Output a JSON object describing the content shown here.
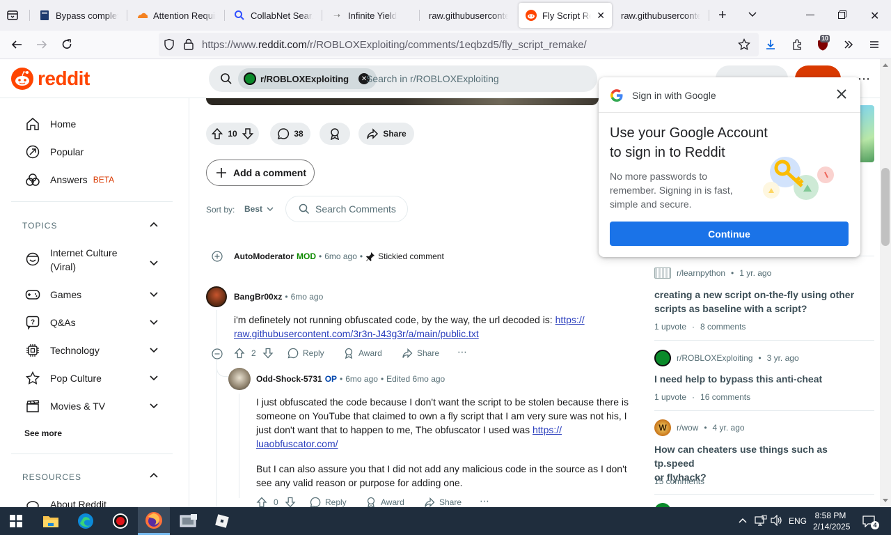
{
  "browser": {
    "tabs": [
      {
        "label": "Bypass complete |",
        "icon": "doc-icon"
      },
      {
        "label": "Attention Require",
        "icon": "cloudflare-icon"
      },
      {
        "label": "CollabNet SearXN",
        "icon": "search-icon"
      },
      {
        "label": "Infinite Yield",
        "icon": "arrow-icon"
      },
      {
        "label": "raw.githubuserconten",
        "icon": "none"
      },
      {
        "label": "Fly Script Rema",
        "icon": "reddit-icon",
        "active": true
      },
      {
        "label": "raw.githubuserconten",
        "icon": "none"
      }
    ],
    "url_prefix": "https://www.",
    "url_domain": "reddit.com",
    "url_path": "/r/ROBLOXExploiting/comments/1eqbzd5/fly_script_remake/",
    "extension_badge": "10"
  },
  "header": {
    "logo_text": "reddit",
    "search_chip": "r/ROBLOXExploiting",
    "search_placeholder": "Search in r/ROBLOXExploiting"
  },
  "sidebar": {
    "items": [
      {
        "label": "Home",
        "icon": "home-icon"
      },
      {
        "label": "Popular",
        "icon": "popular-icon"
      },
      {
        "label": "Answers",
        "badge": "BETA",
        "icon": "answers-icon"
      }
    ],
    "topics_label": "TOPICS",
    "topics": [
      {
        "label": "Internet Culture",
        "label2": "(Viral)",
        "icon": "smile-icon"
      },
      {
        "label": "Games",
        "icon": "gamepad-icon"
      },
      {
        "label": "Q&As",
        "icon": "qa-icon"
      },
      {
        "label": "Technology",
        "icon": "chip-icon"
      },
      {
        "label": "Pop Culture",
        "icon": "star-icon"
      },
      {
        "label": "Movies & TV",
        "icon": "clapper-icon"
      }
    ],
    "see_more": "See more",
    "resources_label": "RESOURCES",
    "about": "About Reddit"
  },
  "post_actions": {
    "votes": "10",
    "comments": "38",
    "share": "Share"
  },
  "add_comment": "Add a comment",
  "sort": {
    "label": "Sort by:",
    "value": "Best"
  },
  "search_comments": "Search Comments",
  "automod": {
    "user": "AutoModerator",
    "flair": "MOD",
    "time": "6mo ago",
    "stickied": "Stickied comment"
  },
  "comment1": {
    "user": "BangBr00xz",
    "time": "6mo ago",
    "text": "i'm definetely not running obfuscated code, by the way, the url decoded is: ",
    "link1": "https://",
    "link2": "raw.githubusercontent.com/3r3n-J43g3r/a/main/public.txt",
    "votes": "2",
    "reply": "Reply",
    "award": "Award",
    "share": "Share"
  },
  "comment2": {
    "user": "Odd-Shock-5731",
    "flair": "OP",
    "time": "6mo ago",
    "edited": "Edited 6mo ago",
    "p1_line1": "I just obfuscated the code because I don't want the script to be stolen because there is",
    "p1_line2": "someone on YouTube that claimed to own a fly script that I am very sure was not his, I",
    "p1_line3": "just don't want that to happen to me, The obfuscator I used was ",
    "link1": "https://",
    "link2": "luaobfuscator.com/",
    "p2_line1": "But I can also assure you that I did not add any malicious code in the source as I don't",
    "p2_line2": "see any valid reason or purpose for adding one.",
    "votes": "0",
    "reply": "Reply",
    "award": "Award",
    "share": "Share"
  },
  "related": [
    {
      "sub": "r/learnpython",
      "age": "1 yr. ago",
      "title1": "creating a new script on-the-fly using other",
      "title2": "scripts as baseline with a script?",
      "upvotes": "1 upvote",
      "comments": "8 comments"
    },
    {
      "sub": "r/ROBLOXExploiting",
      "age": "3 yr. ago",
      "title1": "I need help to bypass this anti-cheat",
      "title2": "",
      "upvotes": "1 upvote",
      "comments": "16 comments"
    },
    {
      "sub": "r/wow",
      "age": "4 yr. ago",
      "title1": "How can cheaters use things such as tp.speed",
      "title2": "or flyhack?",
      "upvotes": "",
      "comments": "15 comments"
    }
  ],
  "google_popup": {
    "header": "Sign in with Google",
    "title1": "Use your Google Account",
    "title2": "to sign in to Reddit",
    "body1": "No more passwords to",
    "body2": "remember. Signing in is fast,",
    "body3": "simple and secure.",
    "button": "Continue"
  },
  "taskbar": {
    "lang": "ENG",
    "time": "8:58 PM",
    "date": "2/14/2025",
    "notif_count": "4"
  },
  "colors": {
    "reddit_orange": "#ff4500",
    "google_blue": "#1a73e8",
    "taskbar": "#1f2d3d"
  }
}
